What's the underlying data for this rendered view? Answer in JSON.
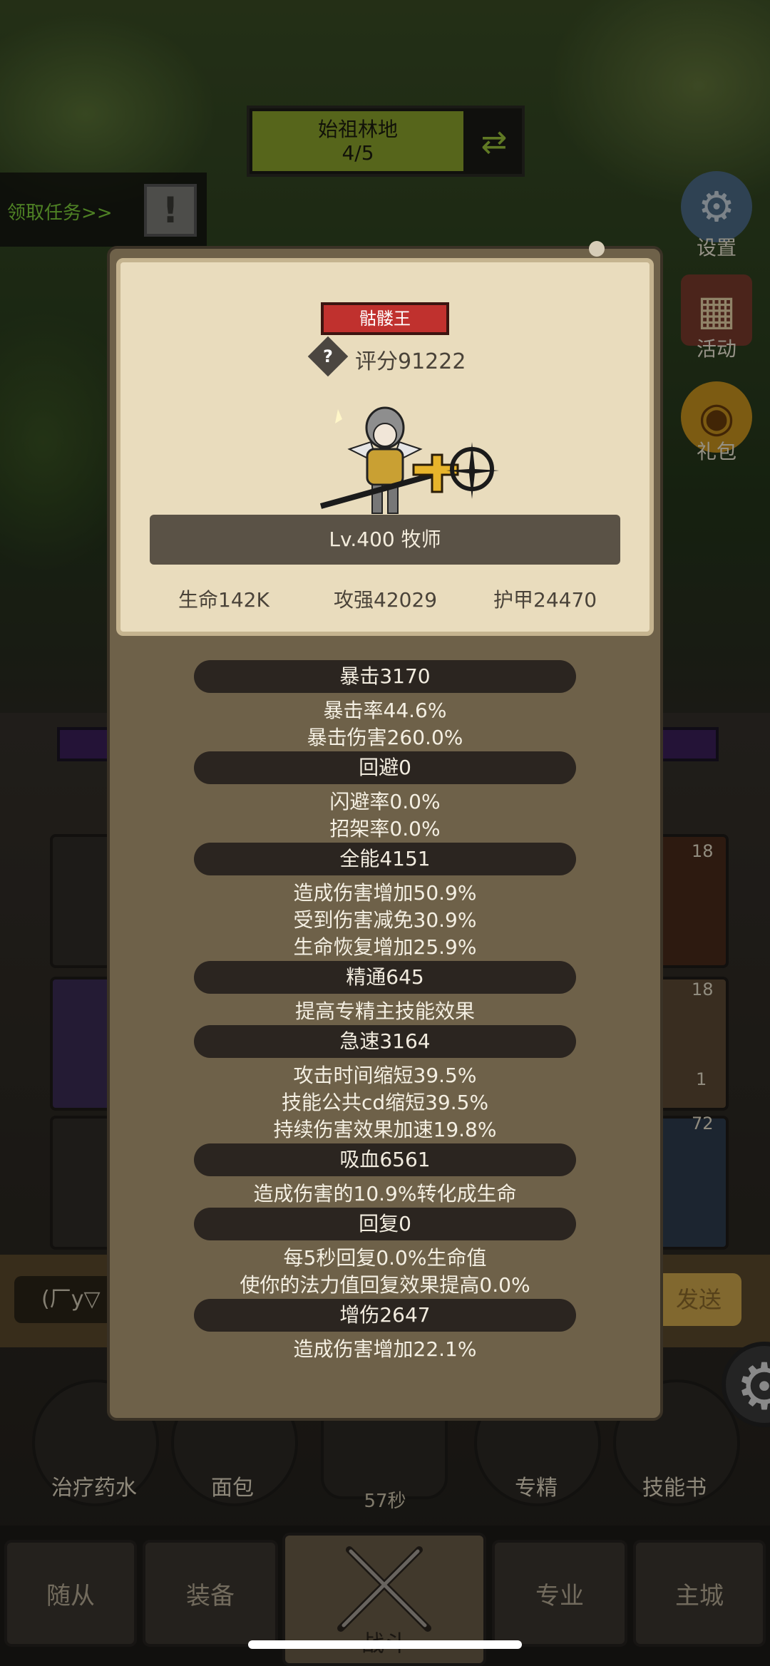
{
  "zone": {
    "name": "始祖林地",
    "progress": "4/5",
    "swap_icon": "swap-arrows-icon"
  },
  "quest": {
    "label": "领取任务>>",
    "icon": "exclamation-icon"
  },
  "right_menu": [
    {
      "label": "设置",
      "icon": "gear-icon"
    },
    {
      "label": "活动",
      "icon": "calendar-icon"
    },
    {
      "label": "礼包",
      "icon": "gift-pot-icon"
    }
  ],
  "side_counts": {
    "a": "18",
    "b": "18",
    "c": "1",
    "d": "72"
  },
  "chat": {
    "input": "(厂y▽",
    "send": "发送"
  },
  "items": [
    {
      "label": "治疗药水"
    },
    {
      "label": "面包"
    },
    {
      "label": "专精"
    },
    {
      "label": "技能书"
    }
  ],
  "timer": "57秒",
  "nav": {
    "follower": "随从",
    "equipment": "装备",
    "battle": "战斗",
    "profession": "专业",
    "main_city": "主城"
  },
  "modal": {
    "boss_tag": "骷髅王",
    "rating": "评分91222",
    "level_class": "Lv.400 牧师",
    "card_stats": {
      "hp": "生命142K",
      "atk": "攻强42029",
      "armor": "护甲24470"
    },
    "sections": [
      {
        "header": "暴击3170",
        "lines": [
          "暴击率44.6%",
          "暴击伤害260.0%"
        ]
      },
      {
        "header": "回避0",
        "lines": [
          "闪避率0.0%",
          "招架率0.0%"
        ]
      },
      {
        "header": "全能4151",
        "lines": [
          "造成伤害增加50.9%",
          "受到伤害减免30.9%",
          "生命恢复增加25.9%"
        ]
      },
      {
        "header": "精通645",
        "lines": [
          "提高专精主技能效果"
        ]
      },
      {
        "header": "急速3164",
        "lines": [
          "攻击时间缩短39.5%",
          "技能公共cd缩短39.5%",
          "持续伤害效果加速19.8%"
        ]
      },
      {
        "header": "吸血6561",
        "lines": [
          "造成伤害的10.9%转化成生命"
        ]
      },
      {
        "header": "回复0",
        "lines": [
          "每5秒回复0.0%生命值",
          "使你的法力值回复效果提高0.0%"
        ]
      },
      {
        "header": "增伤2647",
        "lines": [
          "造成伤害增加22.1%"
        ]
      }
    ]
  }
}
